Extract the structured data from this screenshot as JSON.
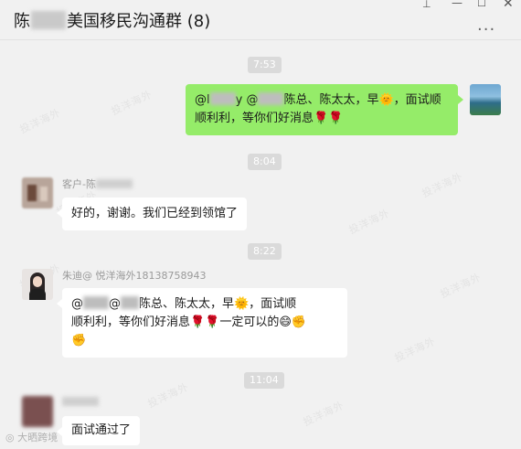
{
  "window": {
    "title": "陈▒▒美国移民沟通群 (8)",
    "title_prefix": "陈",
    "title_suffix": "美国移民沟通群 (8)",
    "more_label": "···",
    "pin_icon": "pin-icon",
    "min_icon": "minimize-icon",
    "max_icon": "maximize-icon",
    "close_icon": "close-icon",
    "pin_glyph": "⊥",
    "min_glyph": "—",
    "max_glyph": "☐",
    "close_glyph": "✕"
  },
  "watermark_text": "投洋海外",
  "timestamps": [
    "7:53",
    "8:04",
    "8:22",
    "11:04"
  ],
  "messages": [
    {
      "side": "right",
      "text_line1_pre": "@l",
      "text_line1_mid": "y @",
      "text_line1_post": "陈总、陈太太，早🌞，面试顺",
      "text_line2": "顺利利，等你们好消息🌹🌹"
    },
    {
      "side": "left",
      "sender": "客户-陈",
      "text": "好的，谢谢。我们已经到领馆了"
    },
    {
      "side": "left",
      "sender": "朱迪@ 悦洋海外18138758943",
      "text_line1_pre": "@",
      "text_line1_mid": "@",
      "text_line1_post": "陈总、陈太太，早🌞，面试顺",
      "text_line2": "顺利利，等你们好消息🌹🌹一定可以的😄✊",
      "text_line3": "✊"
    },
    {
      "side": "left",
      "sender": "",
      "text": "面试通过了"
    }
  ],
  "corner_label": "◎ 大晒跨境",
  "colors": {
    "bubble_self": "#95ec69",
    "bubble_other": "#ffffff",
    "background": "#f1f1f1"
  }
}
